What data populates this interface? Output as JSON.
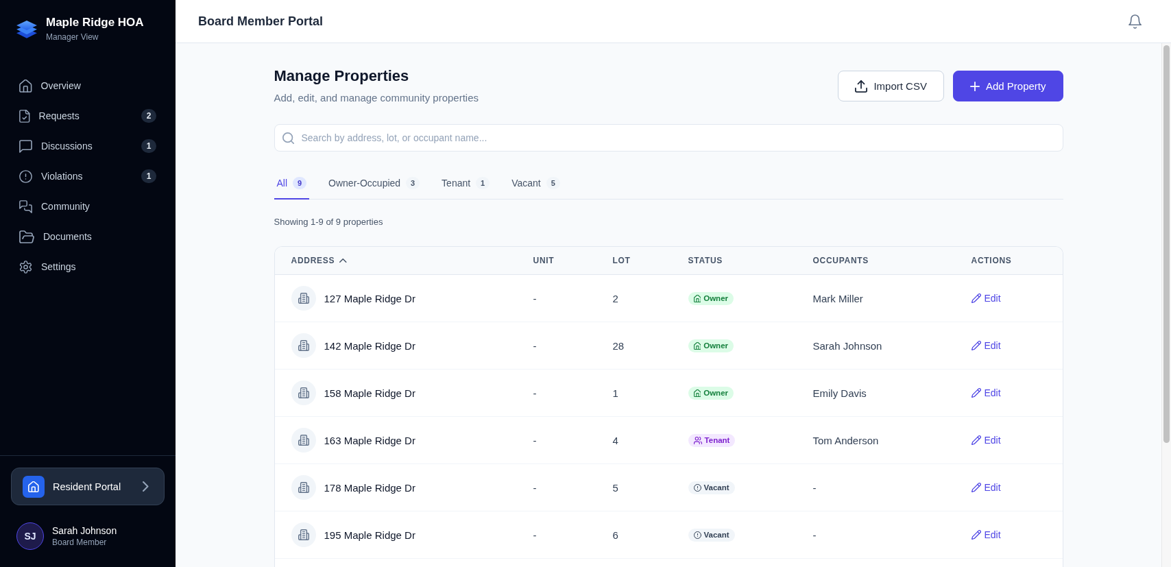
{
  "sidebar": {
    "brand": {
      "title": "Maple Ridge HOA",
      "subtitle": "Manager View"
    },
    "nav": [
      {
        "label": "Overview",
        "selected": false
      },
      {
        "label": "Requests",
        "badge": "2",
        "selected": false
      },
      {
        "label": "Discussions",
        "badge": "1",
        "selected": false
      },
      {
        "label": "Violations",
        "badge": "1",
        "selected": false
      },
      {
        "label": "Community",
        "selected": false
      },
      {
        "label": "Documents",
        "selected": false
      },
      {
        "label": "Settings",
        "selected": false
      }
    ],
    "portal_link": {
      "label": "Resident Portal"
    },
    "user": {
      "initials": "SJ",
      "name": "Sarah Johnson",
      "role": "Board Member"
    }
  },
  "header": {
    "title": "Board Member Portal"
  },
  "page": {
    "title": "Manage Properties",
    "subtitle": "Add, edit, and manage community properties",
    "actions": [
      {
        "kind": "secondary",
        "label": "Import CSV"
      },
      {
        "kind": "primary",
        "label": "Add Property"
      }
    ],
    "search": {
      "placeholder": "Search by address, lot, or occupant name..."
    },
    "tabs": [
      {
        "label": "All",
        "count": "9",
        "selected": true
      },
      {
        "label": "Owner-Occupied",
        "count": "3",
        "selected": false
      },
      {
        "label": "Tenant",
        "count": "1",
        "selected": false
      },
      {
        "label": "Vacant",
        "count": "5",
        "selected": false
      }
    ],
    "summary": "Showing 1-9 of 9 properties",
    "table": {
      "columns": [
        {
          "label": "ADDRESS",
          "sorted": true
        },
        {
          "label": "UNIT",
          "sorted": false
        },
        {
          "label": "LOT",
          "sorted": false
        },
        {
          "label": "STATUS",
          "sorted": false
        },
        {
          "label": "OCCUPANTS",
          "sorted": false
        },
        {
          "label": "ACTIONS",
          "sorted": false
        }
      ],
      "rows": [
        {
          "address": "127 Maple Ridge Dr",
          "unit": "-",
          "lot": "2",
          "status": {
            "kind": "owner",
            "label": "Owner"
          },
          "occupants": "Mark Miller",
          "action": "Edit"
        },
        {
          "address": "142 Maple Ridge Dr",
          "unit": "-",
          "lot": "28",
          "status": {
            "kind": "owner",
            "label": "Owner"
          },
          "occupants": "Sarah Johnson",
          "action": "Edit"
        },
        {
          "address": "158 Maple Ridge Dr",
          "unit": "-",
          "lot": "1",
          "status": {
            "kind": "owner",
            "label": "Owner"
          },
          "occupants": "Emily Davis",
          "action": "Edit"
        },
        {
          "address": "163 Maple Ridge Dr",
          "unit": "-",
          "lot": "4",
          "status": {
            "kind": "tenant",
            "label": "Tenant"
          },
          "occupants": "Tom Anderson",
          "action": "Edit"
        },
        {
          "address": "178 Maple Ridge Dr",
          "unit": "-",
          "lot": "5",
          "status": {
            "kind": "vacant",
            "label": "Vacant"
          },
          "occupants": "-",
          "action": "Edit"
        },
        {
          "address": "195 Maple Ridge Dr",
          "unit": "-",
          "lot": "6",
          "status": {
            "kind": "vacant",
            "label": "Vacant"
          },
          "occupants": "-",
          "action": "Edit"
        }
      ]
    }
  }
}
